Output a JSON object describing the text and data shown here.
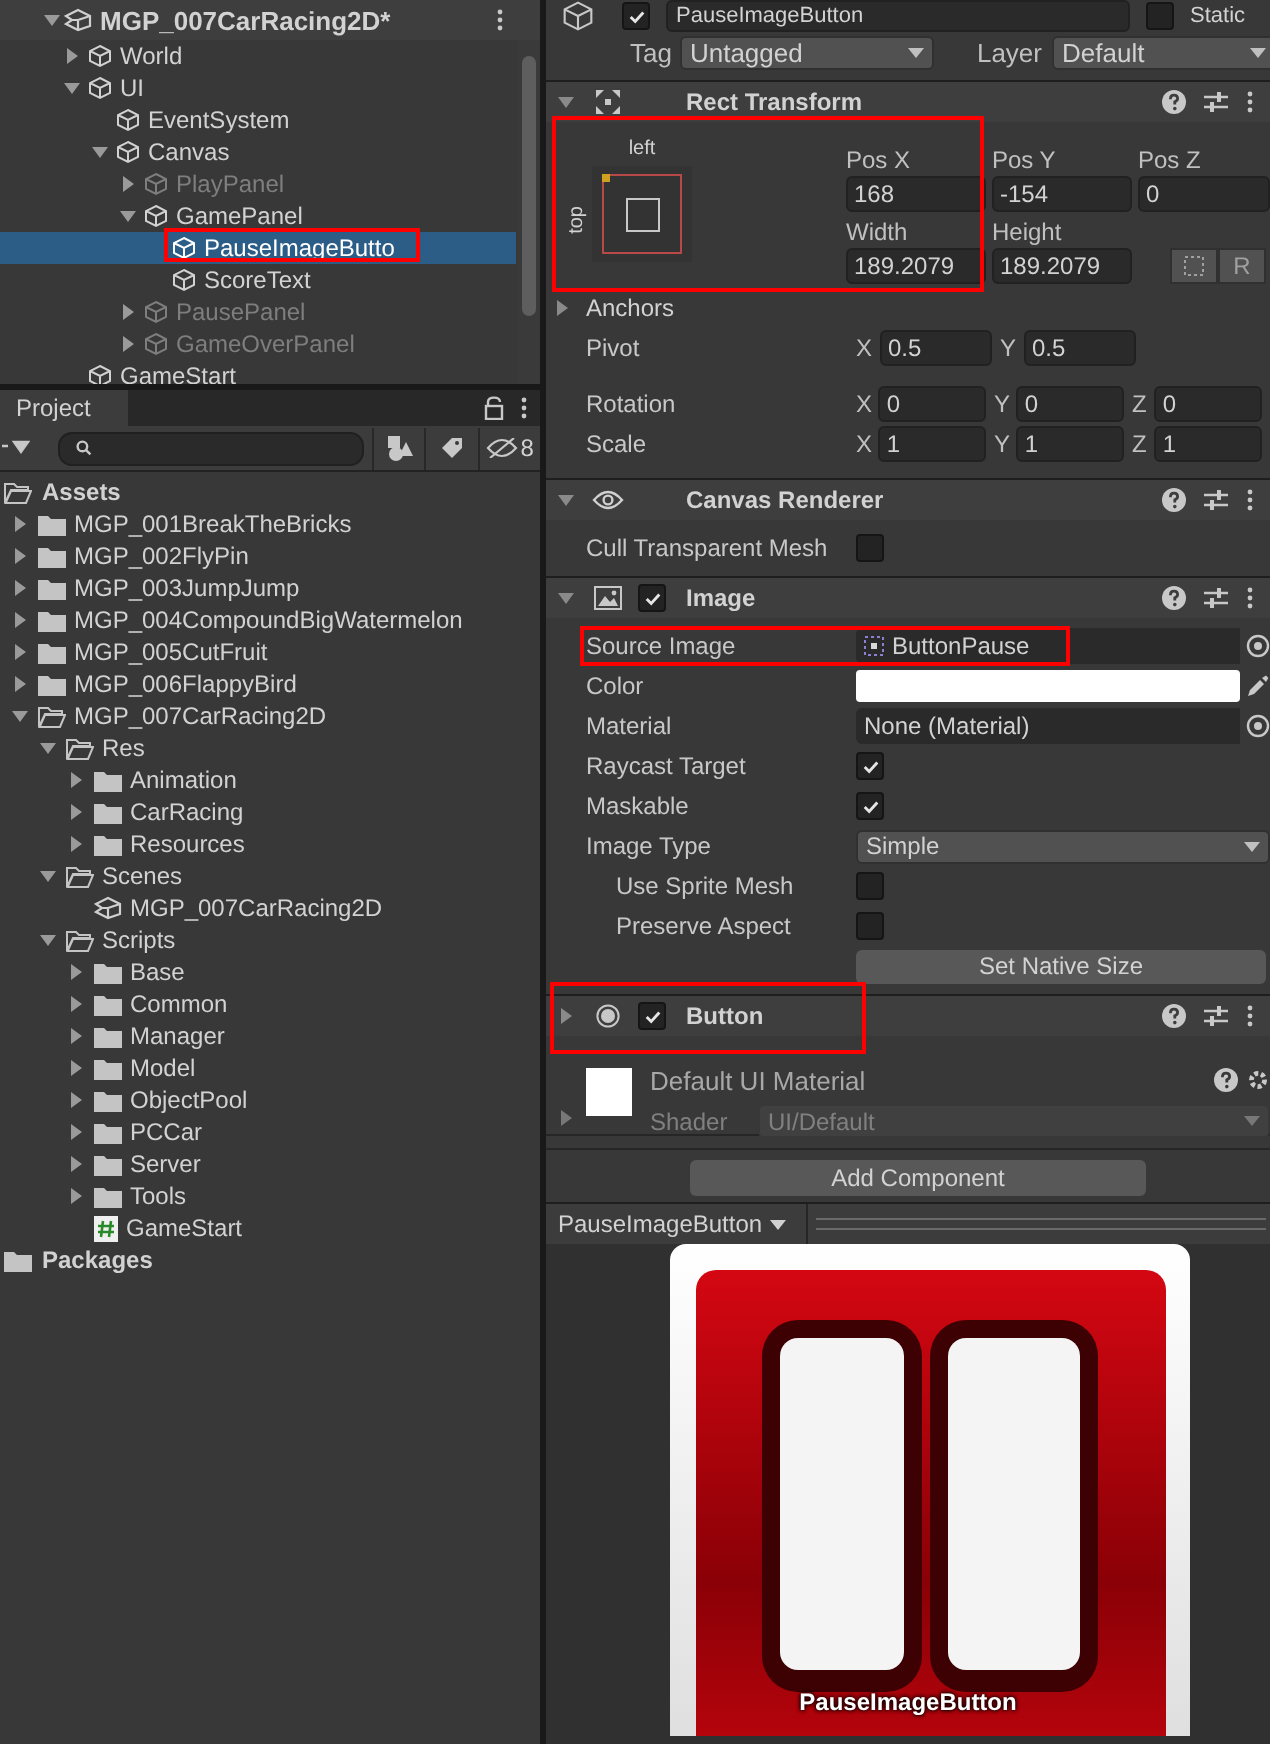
{
  "hierarchy": {
    "scene": {
      "name": "MGP_007CarRacing2D*",
      "expanded": true
    },
    "items": [
      {
        "name": "World",
        "expanded": false,
        "disabled": false,
        "selected": false
      },
      {
        "name": "UI",
        "expanded": true,
        "disabled": false,
        "selected": false,
        "children": [
          {
            "name": "EventSystem",
            "disabled": false,
            "selected": false
          },
          {
            "name": "Canvas",
            "expanded": true,
            "disabled": false,
            "selected": false,
            "children": [
              {
                "name": "PlayPanel",
                "expanded": false,
                "disabled": true,
                "selected": false
              },
              {
                "name": "GamePanel",
                "expanded": true,
                "disabled": false,
                "selected": false,
                "children": [
                  {
                    "name": "PauseImageButto",
                    "disabled": false,
                    "selected": true
                  },
                  {
                    "name": "ScoreText",
                    "disabled": false,
                    "selected": false
                  }
                ]
              },
              {
                "name": "PausePanel",
                "expanded": false,
                "disabled": true,
                "selected": false
              },
              {
                "name": "GameOverPanel",
                "expanded": false,
                "disabled": true,
                "selected": false
              }
            ]
          }
        ]
      },
      {
        "name": "GameStart",
        "disabled": false,
        "selected": false
      }
    ]
  },
  "project": {
    "tab": "Project",
    "hidden_count": "8",
    "tree": [
      {
        "name": "Assets",
        "kind": "folder",
        "expanded": true,
        "children": [
          {
            "name": "MGP_001BreakTheBricks",
            "kind": "folder",
            "expanded": false
          },
          {
            "name": "MGP_002FlyPin",
            "kind": "folder",
            "expanded": false
          },
          {
            "name": "MGP_003JumpJump",
            "kind": "folder",
            "expanded": false
          },
          {
            "name": "MGP_004CompoundBigWatermelon",
            "kind": "folder",
            "expanded": false
          },
          {
            "name": "MGP_005CutFruit",
            "kind": "folder",
            "expanded": false
          },
          {
            "name": "MGP_006FlappyBird",
            "kind": "folder",
            "expanded": false
          },
          {
            "name": "MGP_007CarRacing2D",
            "kind": "folder",
            "expanded": true,
            "children": [
              {
                "name": "Res",
                "kind": "folder",
                "expanded": true,
                "children": [
                  {
                    "name": "Animation",
                    "kind": "folder",
                    "expanded": false
                  },
                  {
                    "name": "CarRacing",
                    "kind": "folder",
                    "expanded": false
                  },
                  {
                    "name": "Resources",
                    "kind": "folder",
                    "expanded": false
                  }
                ]
              },
              {
                "name": "Scenes",
                "kind": "folder",
                "expanded": true,
                "children": [
                  {
                    "name": "MGP_007CarRacing2D",
                    "kind": "scene"
                  }
                ]
              },
              {
                "name": "Scripts",
                "kind": "folder",
                "expanded": true,
                "children": [
                  {
                    "name": "Base",
                    "kind": "folder",
                    "expanded": false
                  },
                  {
                    "name": "Common",
                    "kind": "folder",
                    "expanded": false
                  },
                  {
                    "name": "Manager",
                    "kind": "folder",
                    "expanded": false
                  },
                  {
                    "name": "Model",
                    "kind": "folder",
                    "expanded": false
                  },
                  {
                    "name": "ObjectPool",
                    "kind": "folder",
                    "expanded": false
                  },
                  {
                    "name": "PCCar",
                    "kind": "folder",
                    "expanded": false
                  },
                  {
                    "name": "Server",
                    "kind": "folder",
                    "expanded": false
                  },
                  {
                    "name": "Tools",
                    "kind": "folder",
                    "expanded": false
                  },
                  {
                    "name": "GameStart",
                    "kind": "script"
                  }
                ]
              }
            ]
          }
        ]
      },
      {
        "name": "Packages",
        "kind": "folder",
        "expanded": false
      }
    ]
  },
  "inspector": {
    "object_name": "PauseImageButton",
    "active": true,
    "static_label": "Static",
    "static": false,
    "tag_label": "Tag",
    "tag": "Untagged",
    "layer_label": "Layer",
    "layer": "Default",
    "components": [
      {
        "kind": "rect_transform",
        "title": "Rect Transform",
        "expanded": true,
        "anchor_horizontal": "left",
        "anchor_vertical": "top",
        "fields": [
          {
            "label": "Pos X",
            "value": "168"
          },
          {
            "label": "Pos Y",
            "value": "-154"
          },
          {
            "label": "Pos Z",
            "value": "0"
          },
          {
            "label": "Width",
            "value": "189.2079"
          },
          {
            "label": "Height",
            "value": "189.2079"
          }
        ],
        "raw_button": "R",
        "anchors": {
          "label": "Anchors",
          "expanded": false
        },
        "vectors": [
          {
            "label": "Pivot",
            "axes": [
              {
                "axis": "X",
                "value": "0.5"
              },
              {
                "axis": "Y",
                "value": "0.5"
              }
            ]
          },
          {
            "label": "Rotation",
            "axes": [
              {
                "axis": "X",
                "value": "0"
              },
              {
                "axis": "Y",
                "value": "0"
              },
              {
                "axis": "Z",
                "value": "0"
              }
            ]
          },
          {
            "label": "Scale",
            "axes": [
              {
                "axis": "X",
                "value": "1"
              },
              {
                "axis": "Y",
                "value": "1"
              },
              {
                "axis": "Z",
                "value": "1"
              }
            ]
          }
        ]
      },
      {
        "kind": "canvas_renderer",
        "title": "Canvas Renderer",
        "expanded": true,
        "rows": [
          {
            "kind": "checkbox",
            "label": "Cull Transparent Mesh",
            "checked": false
          }
        ]
      },
      {
        "kind": "image",
        "title": "Image",
        "expanded": true,
        "enabled": true,
        "rows": [
          {
            "kind": "sprite",
            "label": "Source Image",
            "value": "ButtonPause"
          },
          {
            "kind": "color",
            "label": "Color",
            "color": "#ffffff"
          },
          {
            "kind": "object",
            "label": "Material",
            "value": "None (Material)"
          },
          {
            "kind": "checkbox",
            "label": "Raycast Target",
            "checked": true
          },
          {
            "kind": "checkbox",
            "label": "Maskable",
            "checked": true
          },
          {
            "kind": "dropdown",
            "label": "Image Type",
            "value": "Simple",
            "children": [
              {
                "kind": "checkbox",
                "label": "Use Sprite Mesh",
                "checked": false
              },
              {
                "kind": "checkbox",
                "label": "Preserve Aspect",
                "checked": false
              }
            ]
          }
        ],
        "action": "Set Native Size"
      },
      {
        "kind": "button",
        "title": "Button",
        "expanded": false,
        "enabled": true
      }
    ],
    "material": {
      "name": "Default UI Material",
      "shader_label": "Shader",
      "shader": "UI/Default",
      "expanded": false
    },
    "add_component": "Add Component"
  },
  "preview": {
    "title": "PauseImageButton",
    "caption": "PauseImageButton"
  }
}
